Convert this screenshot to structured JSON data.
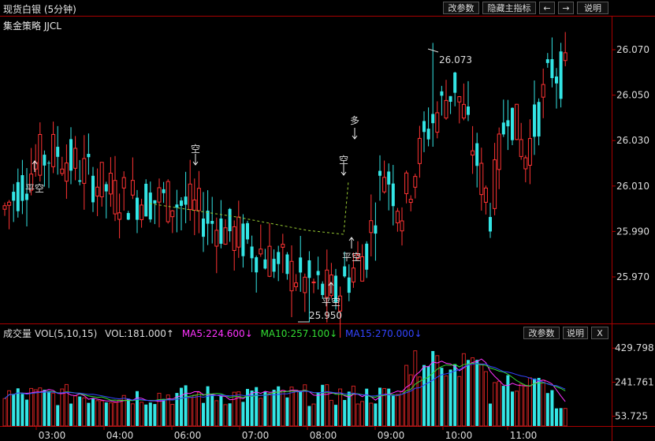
{
  "header": {
    "title": "现货白银 (5分钟)",
    "buttons": [
      "改参数",
      "隐藏主指标",
      "←",
      "→",
      "说明"
    ]
  },
  "main_panel": {
    "strategy_label": "集金策略 JJCL",
    "price_axis": [
      "26.070",
      "26.050",
      "26.030",
      "26.010",
      "25.990",
      "25.970"
    ],
    "high_label": "26.073",
    "low_label": "25.950",
    "signals": [
      {
        "text": "平空",
        "color": "#ff3030",
        "arrow": "up"
      },
      {
        "text": "空",
        "color": "#33dd33",
        "arrow": "down"
      },
      {
        "text": "空",
        "color": "#33dd33",
        "arrow": "down"
      },
      {
        "text": "多",
        "color": "#ff3030",
        "arrow": "down"
      },
      {
        "text": "平空",
        "color": "#ff3030",
        "arrow": "up"
      },
      {
        "text": "平空",
        "color": "#ff3030",
        "arrow": "up"
      }
    ]
  },
  "volume_panel": {
    "label": "成交量",
    "params": "VOL(5,10,15)",
    "vol": "VOL:181.000↑",
    "ma5": "MA5:224.600↓",
    "ma10": "MA10:257.100↓",
    "ma15": "MA15:270.000↓",
    "buttons": [
      "改参数",
      "说明",
      "X"
    ],
    "axis": [
      "429.798",
      "241.761",
      "53.725"
    ]
  },
  "time_axis": [
    "03:00",
    "04:00",
    "06:00",
    "07:00",
    "08:00",
    "09:00",
    "10:00",
    "11:00"
  ],
  "colors": {
    "up": "#ff3333",
    "down": "#33e5e5",
    "ma5": "#ff33ff",
    "ma10": "#33dd33",
    "ma15": "#3344ff",
    "axis": "#aa0000"
  }
}
